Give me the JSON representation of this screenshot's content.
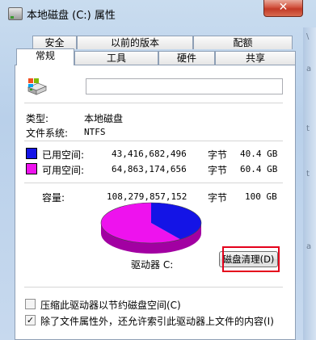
{
  "window": {
    "title": "本地磁盘 (C:) 属性",
    "close_glyph": "✕"
  },
  "right_strip_chars": [
    "\\",
    "a",
    "t",
    "t",
    "a"
  ],
  "tabs_row1": [
    "安全",
    "以前的版本",
    "配额"
  ],
  "tabs_row2": [
    "常规",
    "工具",
    "硬件",
    "共享"
  ],
  "general": {
    "type_label": "类型:",
    "type_value": "本地磁盘",
    "fs_label": "文件系统:",
    "fs_value": "NTFS",
    "used": {
      "label": "已用空间:",
      "bytes": "43,416,682,496",
      "unit": "字节",
      "size": "40.4 GB",
      "color": "#1414e6"
    },
    "free": {
      "label": "可用空间:",
      "bytes": "64,863,174,656",
      "unit": "字节",
      "size": "60.4 GB",
      "color": "#ee12ee"
    },
    "capacity": {
      "label": "容量:",
      "bytes": "108,279,857,152",
      "unit": "字节",
      "size": "100 GB"
    },
    "drive_label": "驱动器 C:",
    "cleanup_button": "磁盘清理(D)",
    "compress_option": {
      "label": "压缩此驱动器以节约磁盘空间(C)",
      "checked": false
    },
    "index_option": {
      "label": "除了文件属性外，还允许索引此驱动器上文件的内容(I)",
      "checked": true
    }
  },
  "usage_fraction_used": 0.401
}
